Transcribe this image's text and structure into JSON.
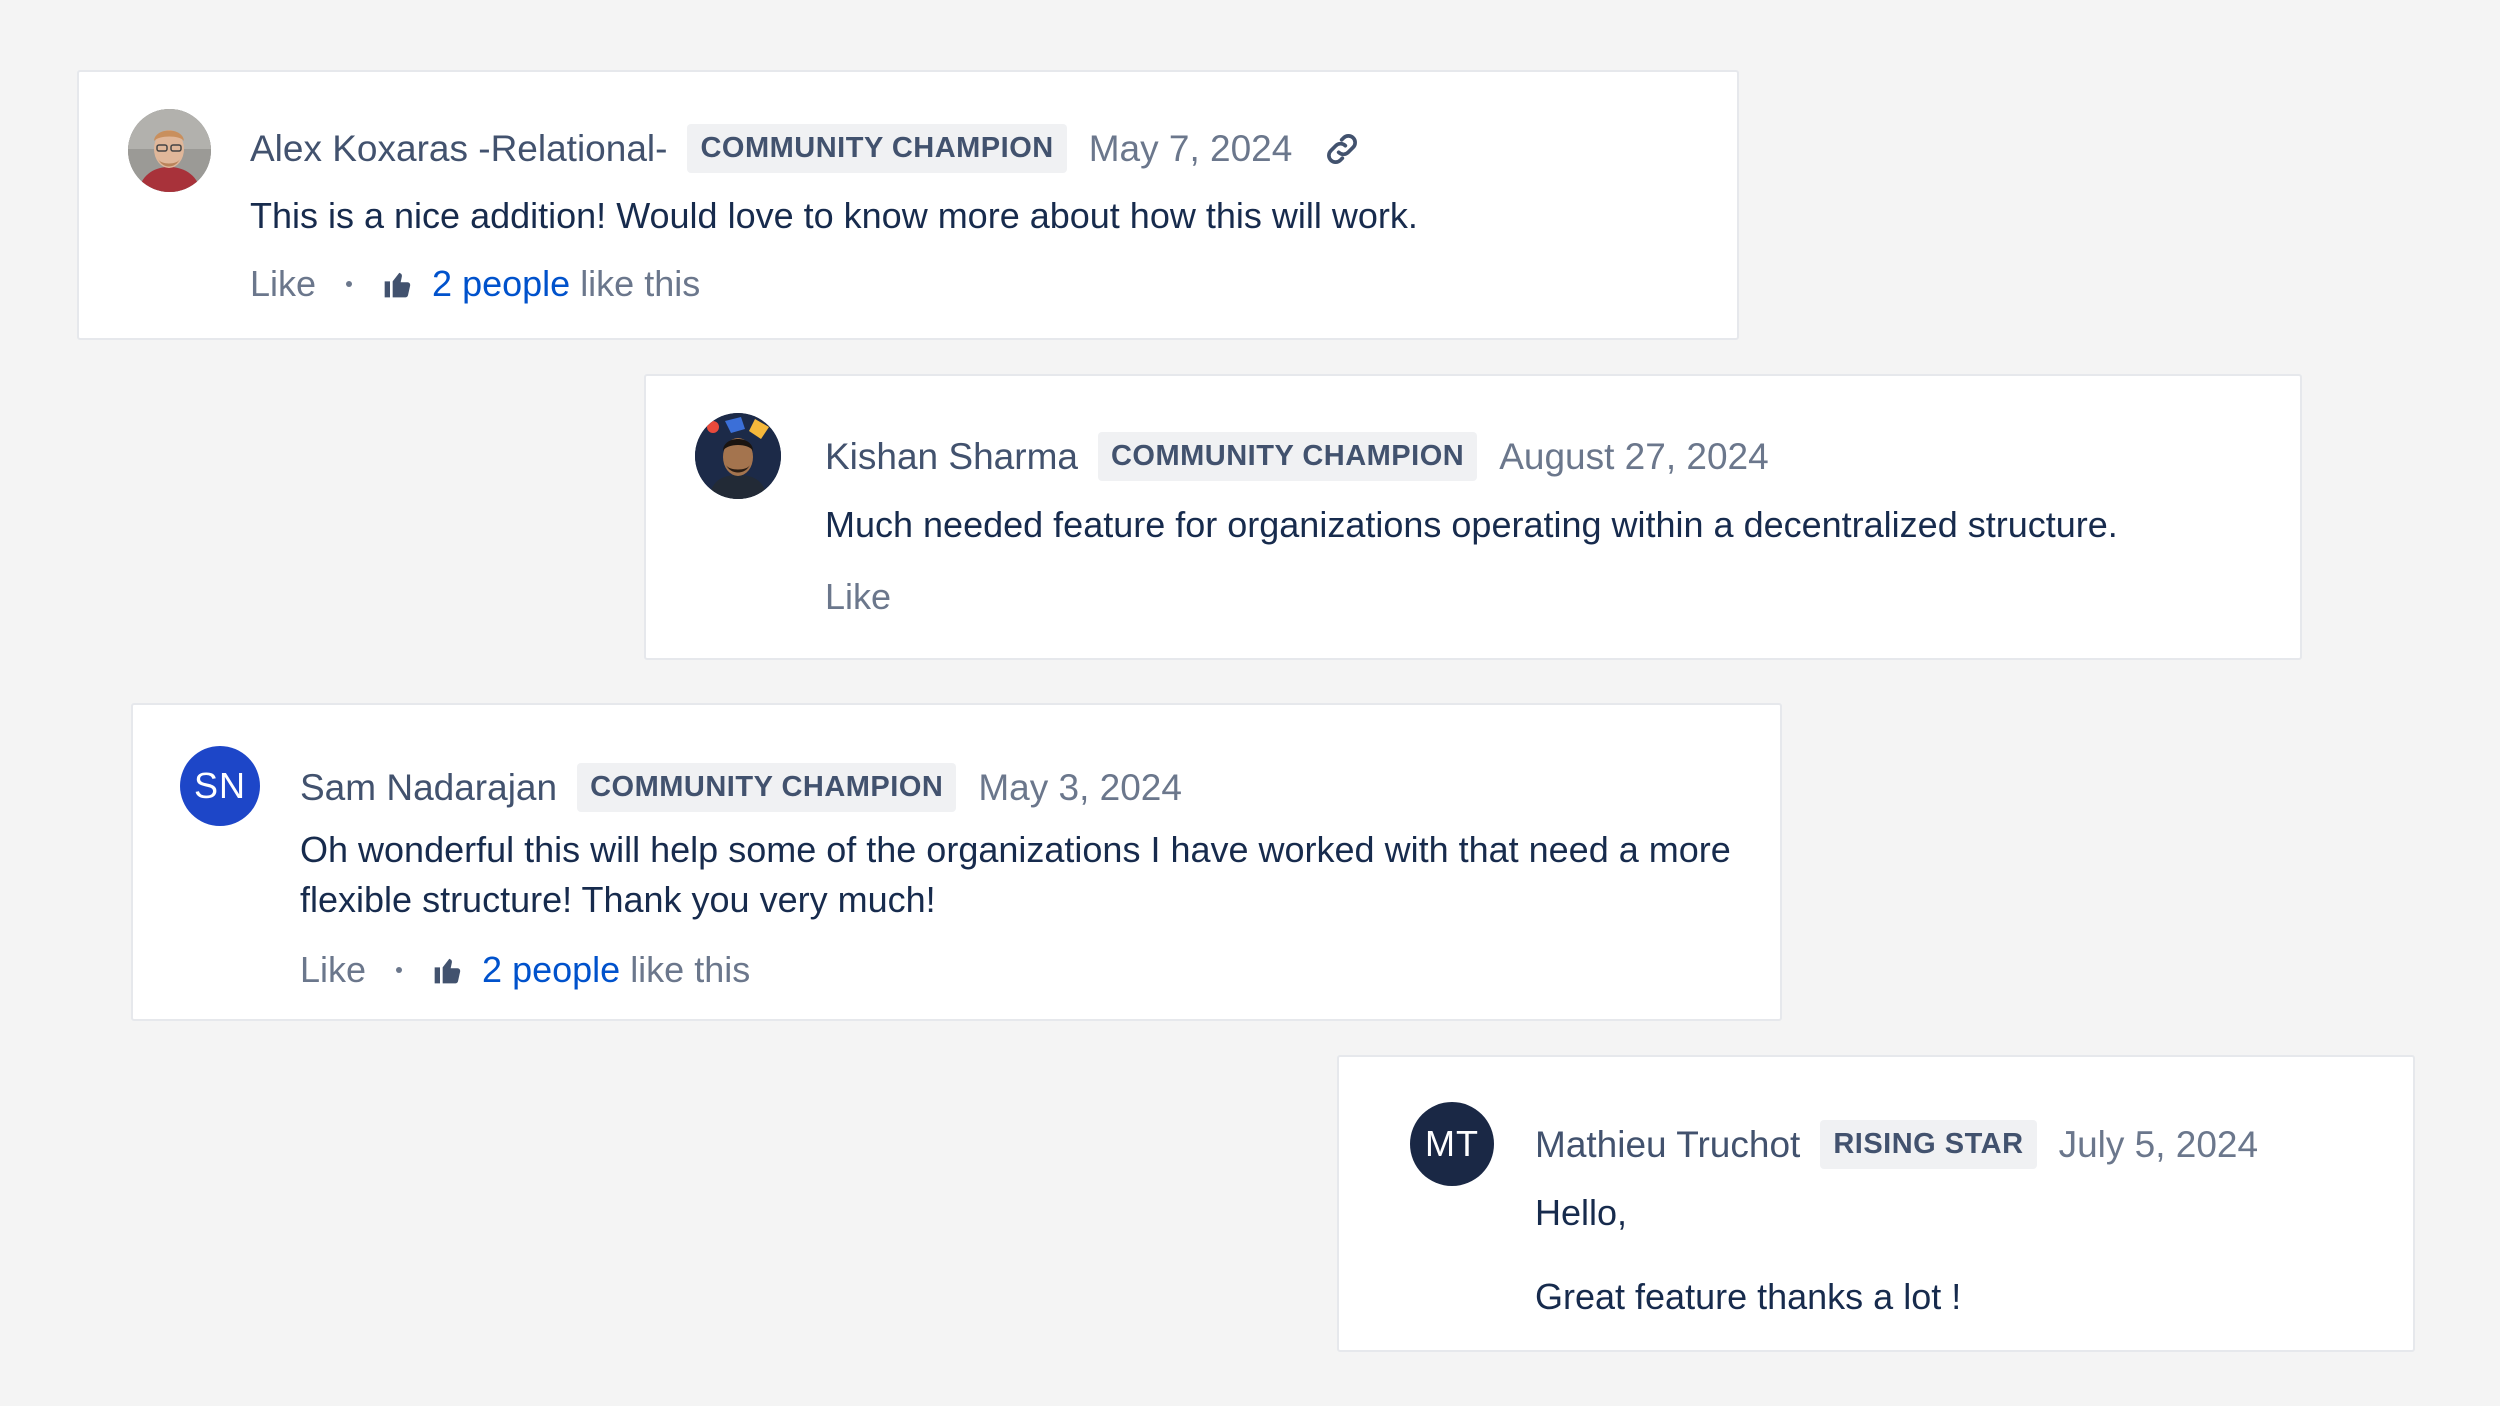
{
  "comments": [
    {
      "author": "Alex Koxaras -Relational-",
      "badge": "COMMUNITY CHAMPION",
      "date": "May 7, 2024",
      "avatar": {
        "type": "photo",
        "icon": "user-photo-avatar"
      },
      "has_link_icon": true,
      "body": [
        "This is a nice addition! Would love to know more about how this will work."
      ],
      "like_label": "Like",
      "likes_link": "2 people",
      "likes_suffix": "like this"
    },
    {
      "author": "Kishan Sharma",
      "badge": "COMMUNITY CHAMPION",
      "date": "August 27, 2024",
      "avatar": {
        "type": "photo",
        "icon": "user-photo-avatar"
      },
      "body": [
        "Much needed feature for organizations operating within a decentralized structure."
      ],
      "like_label": "Like"
    },
    {
      "author": "Sam Nadarajan",
      "badge": "COMMUNITY CHAMPION",
      "date": "May 3, 2024",
      "avatar": {
        "type": "initials",
        "initials": "SN",
        "color": "#1d46c8"
      },
      "body": [
        "Oh wonderful this will help some of the organizations I have worked with that need a more flexible structure! Thank you very much!"
      ],
      "like_label": "Like",
      "likes_link": "2 people",
      "likes_suffix": "like this"
    },
    {
      "author": "Mathieu Truchot",
      "badge": "RISING STAR",
      "date": "July 5, 2024",
      "avatar": {
        "type": "initials",
        "initials": "MT",
        "color": "#1a2845"
      },
      "body": [
        "Hello,",
        "Great feature thanks a lot !"
      ]
    }
  ],
  "colors": {
    "link": "#0052cc",
    "badge_bg": "#f0f1f3",
    "muted": "#6b778c"
  }
}
